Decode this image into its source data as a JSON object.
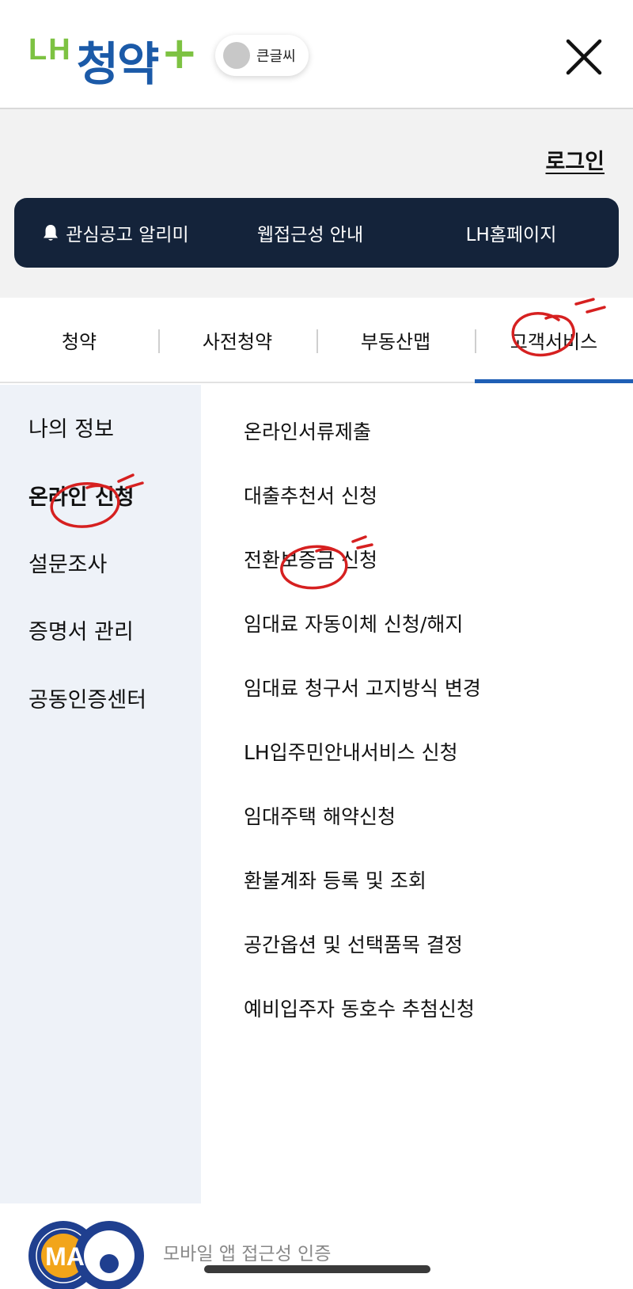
{
  "header": {
    "logo": {
      "lh": "LH",
      "main": "청약",
      "plus": "+"
    },
    "bigtext_toggle_label": "큰글씨"
  },
  "topband": {
    "login_label": "로그인",
    "quick_links": [
      "관심공고 알리미",
      "웹접근성 안내",
      "LH홈페이지"
    ]
  },
  "tabs": [
    {
      "label": "청약"
    },
    {
      "label": "사전청약"
    },
    {
      "label": "부동산맵"
    },
    {
      "label": "고객서비스",
      "active": true
    }
  ],
  "left_menu": [
    {
      "label": "나의 정보"
    },
    {
      "label": "온라인 신청",
      "active": true
    },
    {
      "label": "설문조사"
    },
    {
      "label": "증명서 관리"
    },
    {
      "label": "공동인증센터"
    }
  ],
  "right_menu": [
    "온라인서류제출",
    "대출추천서 신청",
    "전환보증금 신청",
    "임대료 자동이체 신청/해지",
    "임대료 청구서 고지방식 변경",
    "LH입주민안내서비스 신청",
    "임대주택 해약신청",
    "환불계좌 등록 및 조회",
    "공간옵션 및 선택품목 결정",
    "예비입주자 동호수 추첨신청"
  ],
  "footer": {
    "badge_text": "MA",
    "text": "모바일 앱 접근성 인증"
  },
  "colors": {
    "brand_blue": "#1b5aa8",
    "brand_green": "#7dc242",
    "quickbar_bg": "#14233a",
    "active_tab_underline": "#1f5fb5",
    "left_nav_bg": "#eef2f8",
    "annotation_red": "#d62020"
  },
  "icons": [
    "bell-icon",
    "close-icon",
    "mobile-accessibility-badge"
  ]
}
